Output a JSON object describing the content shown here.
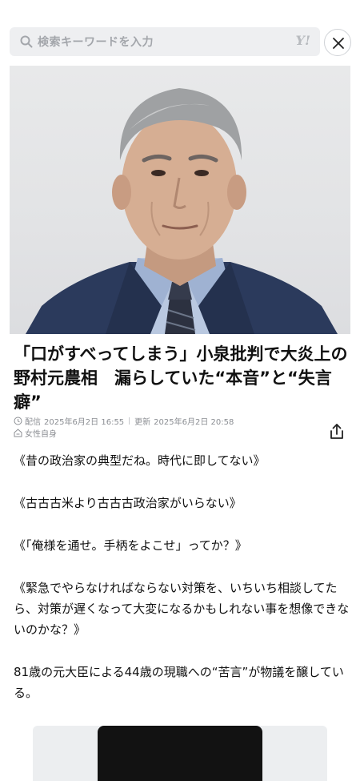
{
  "search": {
    "placeholder": "検索キーワードを入力",
    "logo_text": "Y!"
  },
  "article": {
    "title": "「口がすべってしまう」小泉批判で大炎上の野村元農相　漏らしていた“本音”と“失言癖”",
    "meta": {
      "published_label": "配信",
      "published_time": "2025年6月2日 16:55",
      "updated_label": "更新",
      "updated_time": "2025年6月2日 20:58",
      "source": "女性自身"
    },
    "paragraphs": [
      "《昔の政治家の典型だね。時代に即してない》",
      "《古古古米より古古古政治家がいらない》",
      "《「俺様を通せ。手柄をよこせ」ってか？》",
      "《緊急でやらなければならない対策を、いちいち相談してたら、対策が遅くなって大変になるかもしれない事を想像できないのかな？》",
      "81歳の元大臣による44歳の現職への“苦言”が物議を醸している。"
    ]
  },
  "colors": {
    "search_bg": "#eeeff1",
    "meta_text": "#8b8e93",
    "suit": "#2b3a5c",
    "tie": "#2c3140"
  }
}
